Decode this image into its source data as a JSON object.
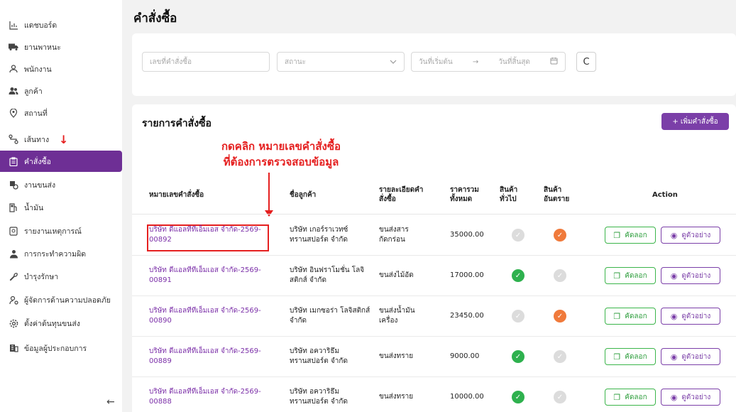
{
  "sidebar": {
    "items": [
      {
        "label": "แดชบอร์ด",
        "icon": "chart-icon"
      },
      {
        "label": "ยานพาหนะ",
        "icon": "truck-icon"
      },
      {
        "label": "พนักงาน",
        "icon": "user-icon"
      },
      {
        "label": "ลูกค้า",
        "icon": "users-icon"
      },
      {
        "label": "สถานที่",
        "icon": "location-icon"
      },
      {
        "label": "เส้นทาง",
        "icon": "route-icon"
      },
      {
        "label": "คำสั่งซื้อ",
        "icon": "clipboard-icon"
      },
      {
        "label": "งานขนส่ง",
        "icon": "delivery-icon"
      },
      {
        "label": "น้ำมัน",
        "icon": "fuel-icon"
      },
      {
        "label": "รายงานเหตุการณ์",
        "icon": "report-icon"
      },
      {
        "label": "การกระทำความผิด",
        "icon": "offender-icon"
      },
      {
        "label": "บำรุงรักษา",
        "icon": "wrench-icon"
      },
      {
        "label": "ผู้จัดการด้านความปลอดภัย",
        "icon": "safety-manager-icon"
      },
      {
        "label": "ตั้งค่าต้นทุนขนส่ง",
        "icon": "settings-icon"
      },
      {
        "label": "ข้อมูลผู้ประกอบการ",
        "icon": "building-icon"
      }
    ],
    "active_index": 6,
    "collapse_glyph": "←"
  },
  "page": {
    "title": "คำสั่งซื้อ"
  },
  "filters": {
    "order_placeholder": "เลขที่คำสั่งซื้อ",
    "status_placeholder": "สถานะ",
    "start_date_placeholder": "วันที่เริ่มต้น",
    "date_separator": "→",
    "end_date_placeholder": "วันที่สิ้นสุด",
    "refresh_glyph": "C"
  },
  "list": {
    "title": "รายการคำสั่งซื้อ",
    "add_button": "+ เพิ่มคำสั่งซื้อ",
    "callout_line1": "กดคลิก หมายเลขคำสั่งซื้อ",
    "callout_line2": "ที่ต้องการตรวจสอบข้อมูล",
    "headers": {
      "order_no": "หมายเลขคำสั่งซื้อ",
      "customer": "ชื่อลูกค้า",
      "detail_1": "รายละเอียดคำ",
      "detail_2": "สั่งซื้อ",
      "total_1": "ราคารวม",
      "total_2": "ทั้งหมด",
      "general_1": "สินค้า",
      "general_2": "ทั่วไป",
      "danger_1": "สินค้า",
      "danger_2": "อันตราย",
      "action": "Action"
    },
    "copy_label": "คัดลอก",
    "view_label": "ดูตัวอย่าง",
    "rows": [
      {
        "order_1": "บริษัท ดีแอลทีทีเอ็มเอส จำกัด-2569-",
        "order_2": "00892",
        "customer_1": "บริษัท เกอร์ราเวทซ์",
        "customer_2": "ทรานสปอร์ต จำกัด",
        "detail_1": "ขนส่งสาร",
        "detail_2": "กัดกร่อน",
        "total": "35000.00",
        "general": false,
        "danger": true
      },
      {
        "order_1": "บริษัท ดีแอลทีทีเอ็มเอส จำกัด-2569-",
        "order_2": "00891",
        "customer_1": "บริษัท อินฟราโมชั่น โลจิ",
        "customer_2": "สติกส์ จำกัด",
        "detail_1": "ขนส่งไม้อัด",
        "detail_2": "",
        "total": "17000.00",
        "general": true,
        "danger": false
      },
      {
        "order_1": "บริษัท ดีแอลทีทีเอ็มเอส จำกัด-2569-",
        "order_2": "00890",
        "customer_1": "บริษัท เมกซอร่า โลจิสติกส์",
        "customer_2": "จำกัด",
        "detail_1": "ขนส่งน้ำมัน",
        "detail_2": "เครื่อง",
        "total": "23450.00",
        "general": false,
        "danger": true
      },
      {
        "order_1": "บริษัท ดีแอลทีทีเอ็มเอส จำกัด-2569-",
        "order_2": "00889",
        "customer_1": "บริษัท อควาริธึม",
        "customer_2": "ทรานสปอร์ต จำกัด",
        "detail_1": "ขนส่งทราย",
        "detail_2": "",
        "total": "9000.00",
        "general": true,
        "danger": false
      },
      {
        "order_1": "บริษัท ดีแอลทีทีเอ็มเอส จำกัด-2569-",
        "order_2": "00888",
        "customer_1": "บริษัท อควาริธึม",
        "customer_2": "ทรานสปอร์ต จำกัด",
        "detail_1": "ขนส่งทราย",
        "detail_2": "",
        "total": "10000.00",
        "general": true,
        "danger": false
      }
    ]
  },
  "colors": {
    "brand": "#7b3fa8",
    "annotation": "#e52020",
    "check_green": "#2eb14e",
    "check_orange": "#f07a3b"
  }
}
